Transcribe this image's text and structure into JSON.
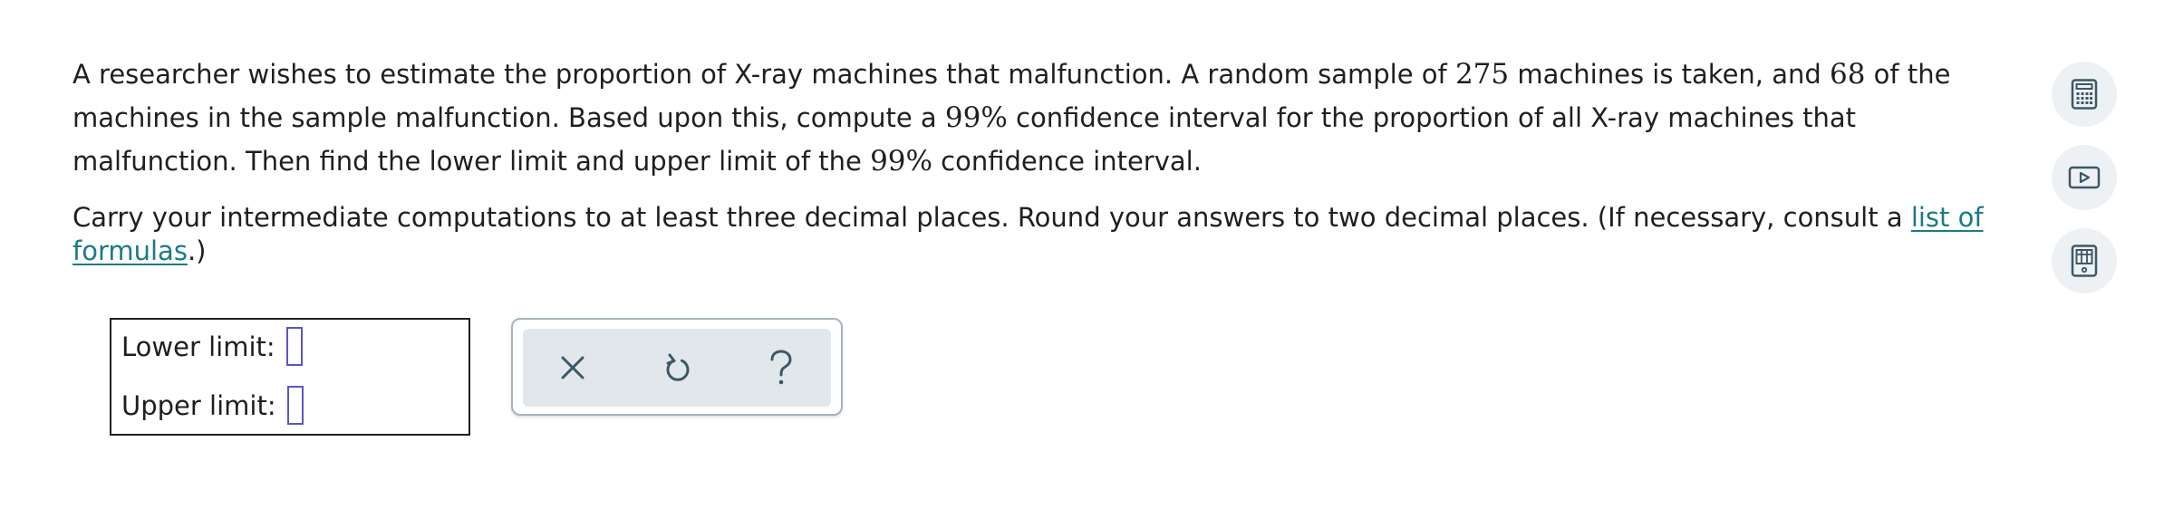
{
  "question": {
    "p1": {
      "t1": "A researcher wishes to estimate the proportion of X-ray machines that malfunction. A random sample of ",
      "n_sample": "275",
      "t2": " machines is taken, and ",
      "n_malfunction": "68",
      "t3": " of the machines in the sample malfunction. Based upon this, compute a ",
      "confidence_1": "99%",
      "t4": " confidence interval for the proportion of all X-ray machines that malfunction. Then find the lower limit and upper limit of the ",
      "confidence_2": "99%",
      "t5": " confidence interval."
    },
    "p2": {
      "text": "Carry your intermediate computations to at least three decimal places. Round your answers to two decimal places. (If necessary, consult a ",
      "link": "list of formulas",
      "tail": ".)"
    }
  },
  "answers": {
    "lower_label": "Lower limit:",
    "lower_value": "",
    "upper_label": "Upper limit:",
    "upper_value": ""
  },
  "tools": [
    {
      "icon": "close-icon"
    },
    {
      "icon": "undo-icon"
    },
    {
      "icon": "help-icon"
    }
  ],
  "side_tools": [
    {
      "icon": "calculator-icon"
    },
    {
      "icon": "video-icon"
    },
    {
      "icon": "data-table-icon"
    }
  ],
  "colors": {
    "link": "#1a7a8a",
    "input_border": "#5b55c9",
    "tool_bg": "#e2e7eb",
    "icon": "#3d5866"
  }
}
